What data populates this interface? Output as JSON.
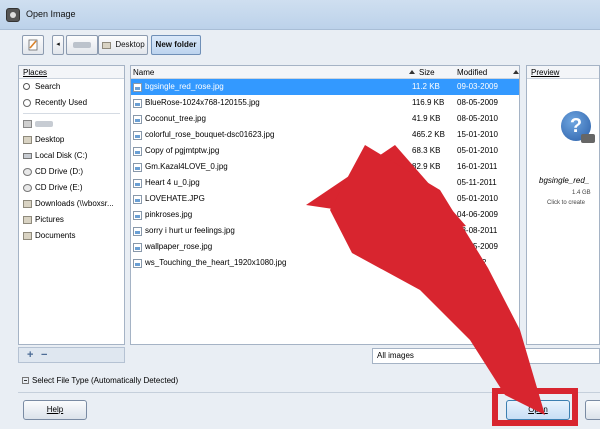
{
  "window": {
    "title": "Open Image"
  },
  "toolbar": {
    "back_glyph": "◂",
    "crumbs": [
      "Desktop",
      "New folder"
    ]
  },
  "places": {
    "header": "Places",
    "items": [
      {
        "label": "Search",
        "icon": "search-icon"
      },
      {
        "label": "Recently Used",
        "icon": "clock-icon"
      },
      {
        "label": "",
        "icon": "home-folder-icon"
      },
      {
        "label": "Desktop",
        "icon": "desktop-folder-icon"
      },
      {
        "label": "Local Disk (C:)",
        "icon": "disk-icon"
      },
      {
        "label": "CD Drive (D:)",
        "icon": "cd-icon"
      },
      {
        "label": "CD Drive (E:)",
        "icon": "cd-icon"
      },
      {
        "label": "Downloads (\\\\vboxsr...",
        "icon": "folder-icon"
      },
      {
        "label": "Pictures",
        "icon": "folder-icon"
      },
      {
        "label": "Documents",
        "icon": "folder-icon"
      }
    ],
    "add_glyph": "+",
    "remove_glyph": "−"
  },
  "files": {
    "columns": {
      "name": "Name",
      "size": "Size",
      "modified": "Modified"
    },
    "rows": [
      {
        "name": "bgsingle_red_rose.jpg",
        "size": "11.2 KB",
        "modified": "09-03-2009",
        "selected": true
      },
      {
        "name": "BlueRose-1024x768-120155.jpg",
        "size": "116.9 KB",
        "modified": "08-05-2009"
      },
      {
        "name": "Coconut_tree.jpg",
        "size": "41.9 KB",
        "modified": "08-05-2010"
      },
      {
        "name": "colorful_rose_bouquet-dsc01623.jpg",
        "size": "465.2 KB",
        "modified": "15-01-2010"
      },
      {
        "name": "Copy of pgjmtptw.jpg",
        "size": "68.3 KB",
        "modified": "05-01-2010"
      },
      {
        "name": "Gm.Kazal4LOVE_0.jpg",
        "size": "82.9 KB",
        "modified": "16-01-2011"
      },
      {
        "name": "Heart 4 u_0.jpg",
        "size": "KB",
        "modified": "05-11-2011"
      },
      {
        "name": "LOVEHATE.JPG",
        "size": "KB",
        "modified": "05-01-2010"
      },
      {
        "name": "pinkroses.jpg",
        "size": "",
        "modified": "04-06-2009"
      },
      {
        "name": "sorry i hurt ur feelings.jpg",
        "size": "",
        "modified": "28-08-2011"
      },
      {
        "name": "wallpaper_rose.jpg",
        "size": "",
        "modified": "08-05-2009"
      },
      {
        "name": "ws_Touching_the_heart_1920x1080.jpg",
        "size": "",
        "modified": "04-2012"
      }
    ]
  },
  "preview": {
    "header": "Preview",
    "icon_glyph": "?",
    "file_name": "bgsingle_red_",
    "size": "1.4 GB",
    "hint": "Click to create"
  },
  "filter": {
    "value": "All images"
  },
  "file_type": {
    "label": "Select File Type (Automatically Detected)"
  },
  "buttons": {
    "help": "Help",
    "open": "Open"
  },
  "colors": {
    "annotation_red": "#d8252f",
    "selection_blue": "#3399ff"
  }
}
